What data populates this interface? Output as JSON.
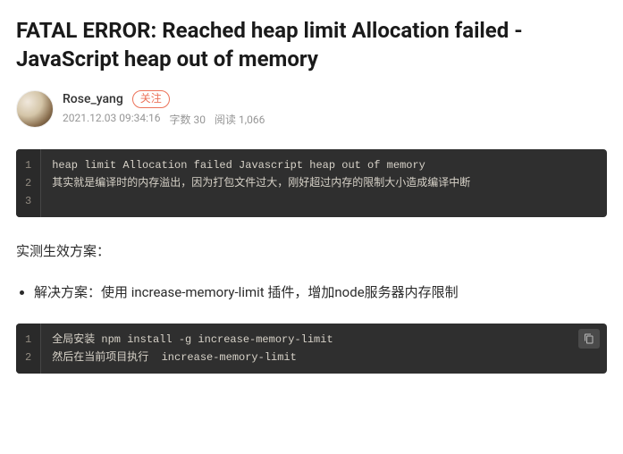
{
  "title": "FATAL ERROR: Reached heap limit Allocation failed - JavaScript heap out of memory",
  "author": {
    "name": "Rose_yang",
    "follow_label": "关注"
  },
  "meta": {
    "datetime": "2021.12.03 09:34:16",
    "word_label": "字数",
    "word_count": "30",
    "read_label": "阅读",
    "read_count": "1,066"
  },
  "code1": {
    "lines": [
      "heap limit Allocation failed Javascript heap out of memory",
      "其实就是编译时的内存溢出，因为打包文件过大，刚好超过内存的限制大小造成编译中断",
      ""
    ]
  },
  "section_heading": "实测生效方案：",
  "bullet1": "解决方案：使用 increase-memory-limit 插件，增加node服务器内存限制",
  "code2": {
    "lines": [
      "全局安装 npm install -g increase-memory-limit",
      "然后在当前项目执行  increase-memory-limit"
    ]
  }
}
